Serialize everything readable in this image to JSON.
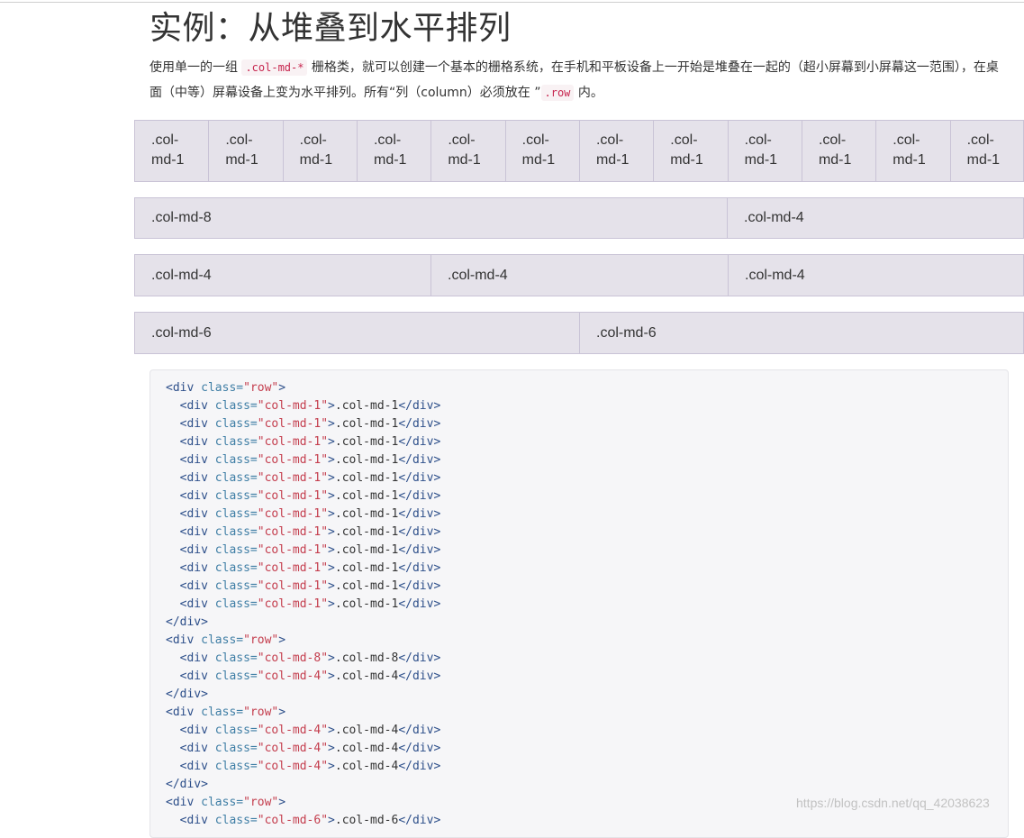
{
  "heading": "实例：从堆叠到水平排列",
  "description": {
    "part1": "使用单一的一组 ",
    "code1": ".col-md-*",
    "part2": " 栅格类，就可以创建一个基本的栅格系统，在手机和平板设备上一开始是堆叠在一起的（超小屏幕到小屏幕这一范围），在桌面（中等）屏幕设备上变为水平排列。所有“列（column）必须放在 ”",
    "code2": ".row",
    "part3": " 内。"
  },
  "grid_demo": {
    "row1": [
      ".col-md-1",
      ".col-md-1",
      ".col-md-1",
      ".col-md-1",
      ".col-md-1",
      ".col-md-1",
      ".col-md-1",
      ".col-md-1",
      ".col-md-1",
      ".col-md-1",
      ".col-md-1",
      ".col-md-1"
    ],
    "row2": [
      ".col-md-8",
      ".col-md-4"
    ],
    "row3": [
      ".col-md-4",
      ".col-md-4",
      ".col-md-4"
    ],
    "row4": [
      ".col-md-6",
      ".col-md-6"
    ]
  },
  "code": {
    "lines": [
      {
        "indent": "",
        "kind": "open",
        "cls": "row",
        "text": ""
      },
      {
        "indent": "  ",
        "kind": "div",
        "cls": "col-md-1",
        "text": ".col-md-1"
      },
      {
        "indent": "  ",
        "kind": "div",
        "cls": "col-md-1",
        "text": ".col-md-1"
      },
      {
        "indent": "  ",
        "kind": "div",
        "cls": "col-md-1",
        "text": ".col-md-1"
      },
      {
        "indent": "  ",
        "kind": "div",
        "cls": "col-md-1",
        "text": ".col-md-1"
      },
      {
        "indent": "  ",
        "kind": "div",
        "cls": "col-md-1",
        "text": ".col-md-1"
      },
      {
        "indent": "  ",
        "kind": "div",
        "cls": "col-md-1",
        "text": ".col-md-1"
      },
      {
        "indent": "  ",
        "kind": "div",
        "cls": "col-md-1",
        "text": ".col-md-1"
      },
      {
        "indent": "  ",
        "kind": "div",
        "cls": "col-md-1",
        "text": ".col-md-1"
      },
      {
        "indent": "  ",
        "kind": "div",
        "cls": "col-md-1",
        "text": ".col-md-1"
      },
      {
        "indent": "  ",
        "kind": "div",
        "cls": "col-md-1",
        "text": ".col-md-1"
      },
      {
        "indent": "  ",
        "kind": "div",
        "cls": "col-md-1",
        "text": ".col-md-1"
      },
      {
        "indent": "  ",
        "kind": "div",
        "cls": "col-md-1",
        "text": ".col-md-1"
      },
      {
        "indent": "",
        "kind": "close",
        "cls": "",
        "text": ""
      },
      {
        "indent": "",
        "kind": "open",
        "cls": "row",
        "text": ""
      },
      {
        "indent": "  ",
        "kind": "div",
        "cls": "col-md-8",
        "text": ".col-md-8"
      },
      {
        "indent": "  ",
        "kind": "div",
        "cls": "col-md-4",
        "text": ".col-md-4"
      },
      {
        "indent": "",
        "kind": "close",
        "cls": "",
        "text": ""
      },
      {
        "indent": "",
        "kind": "open",
        "cls": "row",
        "text": ""
      },
      {
        "indent": "  ",
        "kind": "div",
        "cls": "col-md-4",
        "text": ".col-md-4"
      },
      {
        "indent": "  ",
        "kind": "div",
        "cls": "col-md-4",
        "text": ".col-md-4"
      },
      {
        "indent": "  ",
        "kind": "div",
        "cls": "col-md-4",
        "text": ".col-md-4"
      },
      {
        "indent": "",
        "kind": "close",
        "cls": "",
        "text": ""
      },
      {
        "indent": "",
        "kind": "open",
        "cls": "row",
        "text": ""
      },
      {
        "indent": "  ",
        "kind": "div",
        "cls": "col-md-6",
        "text": ".col-md-6"
      }
    ]
  },
  "watermark": "https://blog.csdn.net/qq_42038623",
  "colors": {
    "cell_bg": "#e5e2ea",
    "cell_border": "#c9c3d6",
    "code_tag": "#2d4f8a",
    "code_attr": "#3f7ea5",
    "code_value": "#c43d4d",
    "inline_code": "#c7254e"
  }
}
